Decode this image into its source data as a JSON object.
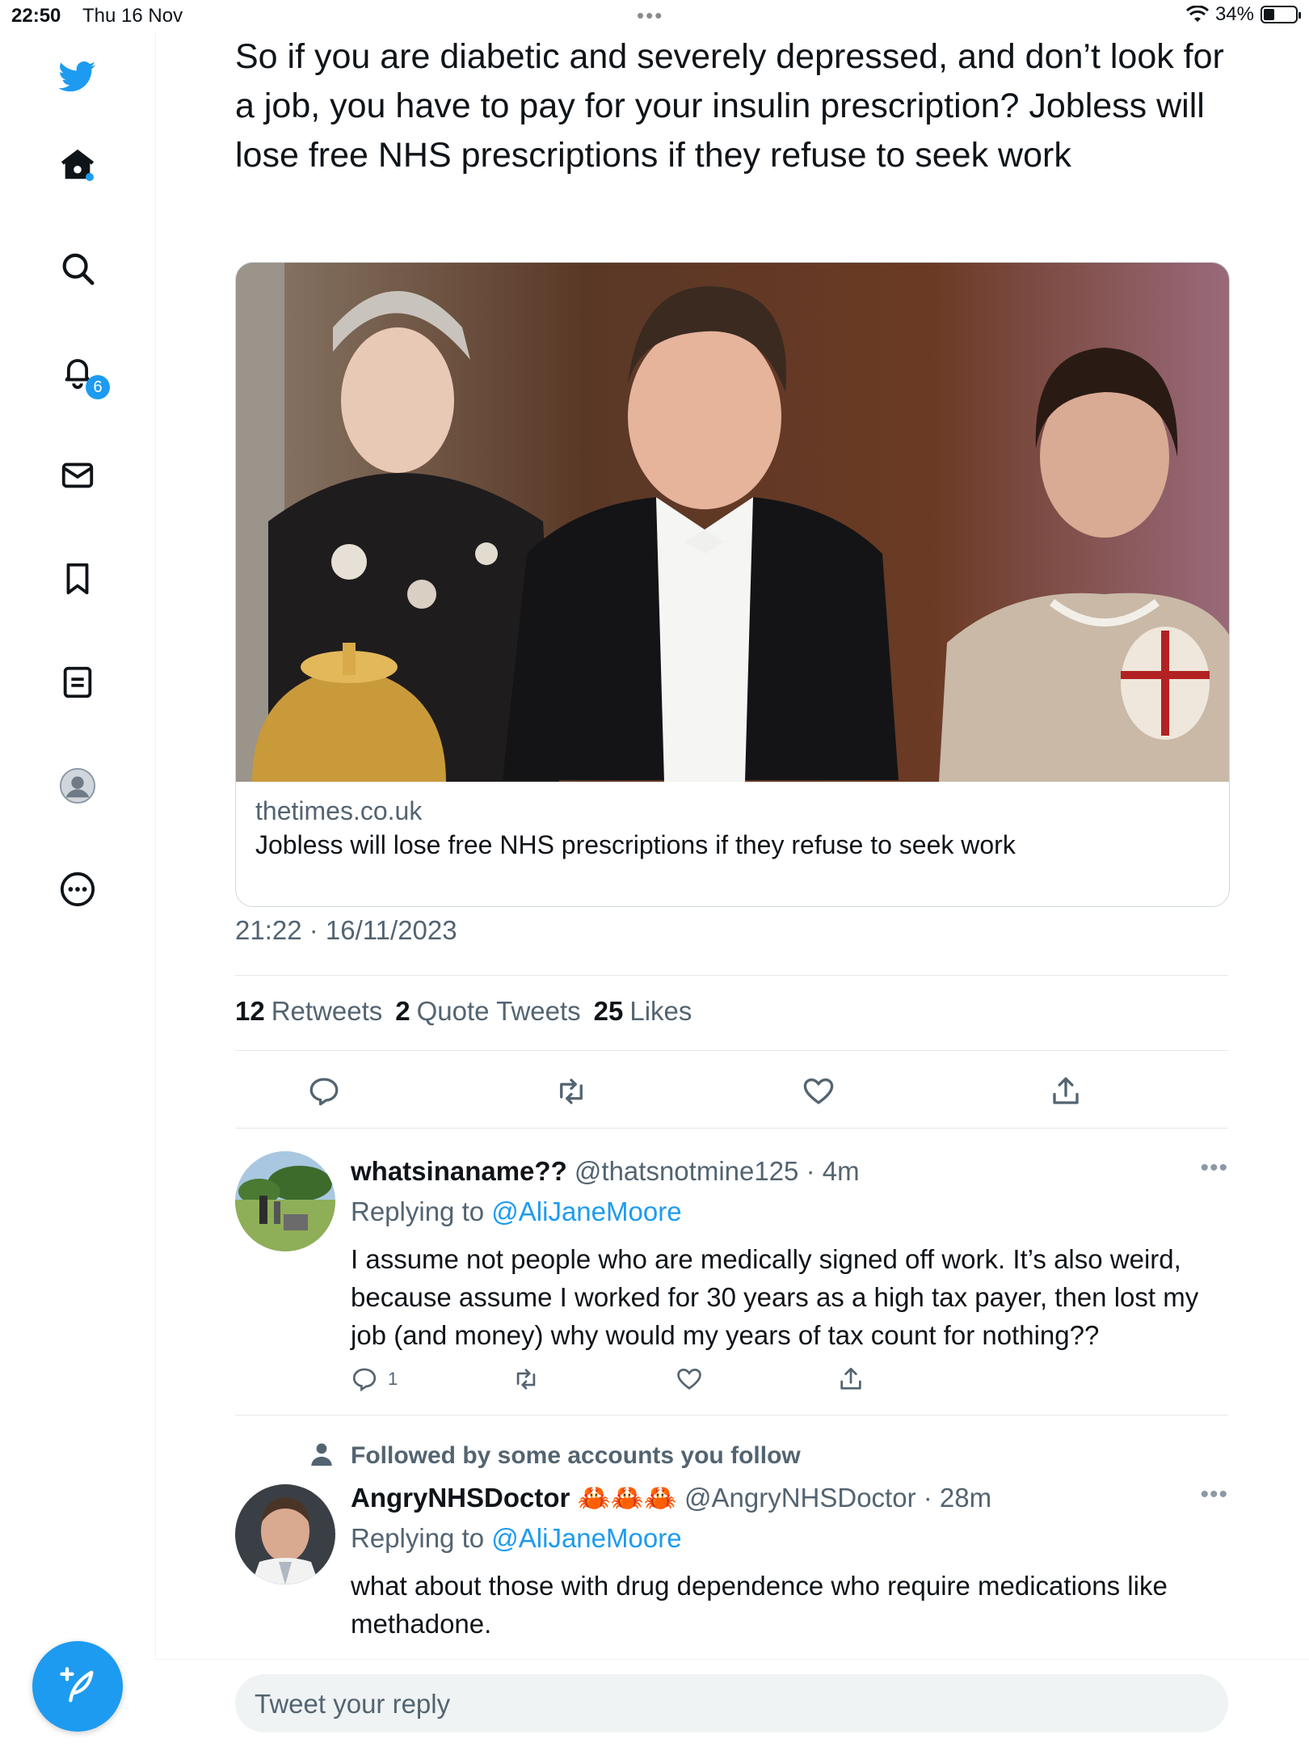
{
  "status_bar": {
    "time": "22:50",
    "date": "Thu 16 Nov",
    "battery": "34%",
    "battery_level": 0.34
  },
  "nav": {
    "notifications_badge": "6",
    "icons": [
      "twitter-bird-icon",
      "home-icon",
      "search-icon",
      "notifications-icon",
      "messages-icon",
      "bookmarks-icon",
      "lists-icon",
      "profile-icon",
      "more-icon"
    ]
  },
  "tweet": {
    "text": "So if you are diabetic and severely depressed, and don’t look for a job, you have to pay for your insulin prescription? Jobless will lose free NHS prescriptions if they refuse to seek work",
    "card": {
      "domain": "thetimes.co.uk",
      "title": "Jobless will lose free NHS prescriptions if they refuse to seek work"
    },
    "timestamp": "21:22 · 16/11/2023",
    "stats": {
      "retweets_count": "12",
      "retweets_label": "Retweets",
      "quotes_count": "2",
      "quotes_label": "Quote Tweets",
      "likes_count": "25",
      "likes_label": "Likes"
    }
  },
  "replies": [
    {
      "name": "whatsinaname??",
      "handle": "@thatsnotmine125",
      "time": "· 4m",
      "replying_prefix": "Replying to",
      "replying_to": "@AliJaneMoore",
      "text": "I assume not people who are medically signed off work. It’s also weird, because assume I worked for 30 years as a high tax payer, then lost my job (and money) why would my years of tax count for nothing??",
      "reply_count": "1"
    },
    {
      "social_context": "Followed by some accounts you follow",
      "name": "AngryNHSDoctor",
      "name_emoji": "🦀🦀🦀",
      "handle": "@AngryNHSDoctor",
      "time": "· 28m",
      "replying_prefix": "Replying to",
      "replying_to": "@AliJaneMoore",
      "text": "what about those with drug dependence who require medications like methadone."
    }
  ],
  "compose": {
    "placeholder": "Tweet your reply"
  },
  "colors": {
    "accent": "#1d9bf0",
    "text": "#0f1419",
    "secondary": "#536471",
    "divider": "#e4e9ec"
  }
}
